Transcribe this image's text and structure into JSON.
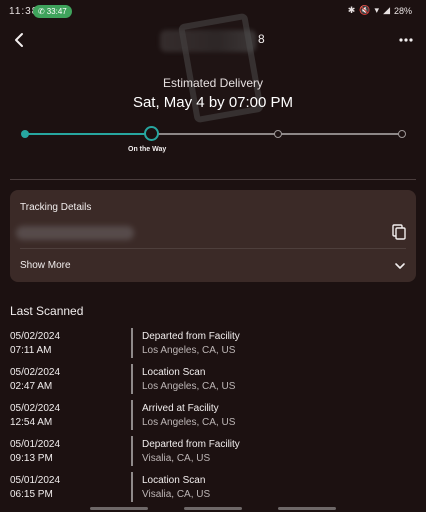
{
  "status_bar": {
    "time": "11:38",
    "call_timer": "33:47",
    "battery": "28%"
  },
  "header": {
    "title_suffix": "8"
  },
  "delivery": {
    "estimate_label": "Estimated Delivery",
    "estimate_date": "Sat, May 4 by 07:00 PM"
  },
  "progress": {
    "current_step_label": "On the Way",
    "current_step": 2,
    "total_steps": 4
  },
  "tracking_card": {
    "title": "Tracking Details",
    "show_more": "Show More"
  },
  "last_scanned": {
    "title": "Last Scanned",
    "scans": [
      {
        "date": "05/02/2024",
        "time": "07:11 AM",
        "status": "Departed from Facility",
        "location": "Los Angeles, CA, US"
      },
      {
        "date": "05/02/2024",
        "time": "02:47 AM",
        "status": "Location Scan",
        "location": "Los Angeles, CA, US"
      },
      {
        "date": "05/02/2024",
        "time": "12:54 AM",
        "status": "Arrived at Facility",
        "location": "Los Angeles, CA, US"
      },
      {
        "date": "05/01/2024",
        "time": "09:13 PM",
        "status": "Departed from Facility",
        "location": "Visalia, CA, US"
      },
      {
        "date": "05/01/2024",
        "time": "06:15 PM",
        "status": "Location Scan",
        "location": "Visalia, CA, US"
      }
    ]
  },
  "icons": {
    "back": "back-arrow-icon",
    "more": "more-vert-icon",
    "copy": "copy-icon",
    "expand": "chevron-down-icon"
  },
  "colors": {
    "background": "#1c1111",
    "accent": "#27a6a0",
    "card": "#3b2a27"
  }
}
